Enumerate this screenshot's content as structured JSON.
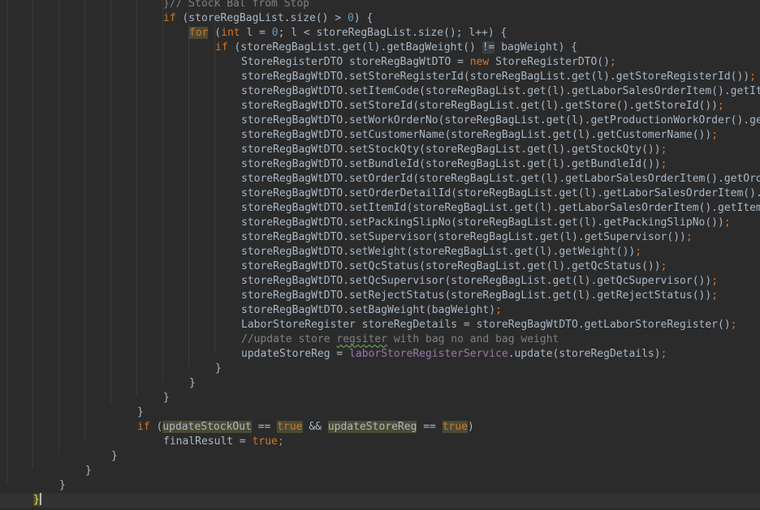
{
  "editor": {
    "lines": [
      {
        "indent": 6,
        "segs": [
          {
            "t": "}// Stock Bal from Stop",
            "k": "cmt"
          }
        ]
      },
      {
        "indent": 6,
        "segs": [
          {
            "t": "if",
            "k": "kw"
          },
          {
            "t": " (storeRegBagList.size() > "
          },
          {
            "t": "0",
            "k": "num"
          },
          {
            "t": ") {"
          }
        ]
      },
      {
        "indent": 7,
        "segs": [
          {
            "t": "for",
            "k": "kwhl"
          },
          {
            "t": " ("
          },
          {
            "t": "int",
            "k": "kw"
          },
          {
            "t": " l = "
          },
          {
            "t": "0",
            "k": "num"
          },
          {
            "t": "; l < storeRegBagList.size(); l++) {"
          }
        ]
      },
      {
        "indent": 8,
        "segs": [
          {
            "t": "if",
            "k": "kw"
          },
          {
            "t": " (storeRegBagList.get(l).getBagWeight() "
          },
          {
            "t": "!=",
            "k": "op"
          },
          {
            "t": " bagWeight) {"
          }
        ]
      },
      {
        "indent": 9,
        "segs": [
          {
            "t": "StoreRegisterDTO storeRegBagWtDTO = "
          },
          {
            "t": "new",
            "k": "kw"
          },
          {
            "t": " StoreRegisterDTO()"
          },
          {
            "t": ";",
            "k": "kw"
          }
        ]
      },
      {
        "indent": 9,
        "segs": [
          {
            "t": "storeRegBagWtDTO.setStoreRegisterId(storeRegBagList.get(l).getStoreRegisterId())"
          },
          {
            "t": ";",
            "k": "kw"
          }
        ]
      },
      {
        "indent": 9,
        "segs": [
          {
            "t": "storeRegBagWtDTO.setItemCode(storeRegBagList.get(l).getLaborSalesOrderItem().getItemCode())"
          },
          {
            "t": ";",
            "k": "kw"
          }
        ]
      },
      {
        "indent": 9,
        "segs": [
          {
            "t": "storeRegBagWtDTO.setStoreId(storeRegBagList.get(l).getStore().getStoreId())"
          },
          {
            "t": ";",
            "k": "kw"
          }
        ]
      },
      {
        "indent": 9,
        "segs": [
          {
            "t": "storeRegBagWtDTO.setWorkOrderNo(storeRegBagList.get(l).getProductionWorkOrder().getWorkOrderNo())"
          },
          {
            "t": ";",
            "k": "kw"
          }
        ]
      },
      {
        "indent": 9,
        "segs": [
          {
            "t": "storeRegBagWtDTO.setCustomerName(storeRegBagList.get(l).getCustomerName())"
          },
          {
            "t": ";",
            "k": "kw"
          }
        ]
      },
      {
        "indent": 9,
        "segs": [
          {
            "t": "storeRegBagWtDTO.setStockQty(storeRegBagList.get(l).getStockQty())"
          },
          {
            "t": ";",
            "k": "kw"
          }
        ]
      },
      {
        "indent": 9,
        "segs": [
          {
            "t": "storeRegBagWtDTO.setBundleId(storeRegBagList.get(l).getBundleId())"
          },
          {
            "t": ";",
            "k": "kw"
          }
        ]
      },
      {
        "indent": 9,
        "segs": [
          {
            "t": "storeRegBagWtDTO.setOrderId(storeRegBagList.get(l).getLaborSalesOrderItem().getOrderId())"
          },
          {
            "t": ";",
            "k": "kw"
          }
        ]
      },
      {
        "indent": 9,
        "segs": [
          {
            "t": "storeRegBagWtDTO.setOrderDetailId(storeRegBagList.get(l).getLaborSalesOrderItem().getOrderDetailId())"
          },
          {
            "t": ";",
            "k": "kw"
          }
        ]
      },
      {
        "indent": 9,
        "segs": [
          {
            "t": "storeRegBagWtDTO.setItemId(storeRegBagList.get(l).getLaborSalesOrderItem().getItemId())"
          },
          {
            "t": ";",
            "k": "kw"
          }
        ]
      },
      {
        "indent": 9,
        "segs": [
          {
            "t": "storeRegBagWtDTO.setPackingSlipNo(storeRegBagList.get(l).getPackingSlipNo())"
          },
          {
            "t": ";",
            "k": "kw"
          }
        ]
      },
      {
        "indent": 9,
        "segs": [
          {
            "t": "storeRegBagWtDTO.setSupervisor(storeRegBagList.get(l).getSupervisor())"
          },
          {
            "t": ";",
            "k": "kw"
          }
        ]
      },
      {
        "indent": 9,
        "segs": [
          {
            "t": "storeRegBagWtDTO.setWeight(storeRegBagList.get(l).getWeight())"
          },
          {
            "t": ";",
            "k": "kw"
          }
        ]
      },
      {
        "indent": 9,
        "segs": [
          {
            "t": "storeRegBagWtDTO.setQcStatus(storeRegBagList.get(l).getQcStatus())"
          },
          {
            "t": ";",
            "k": "kw"
          }
        ]
      },
      {
        "indent": 9,
        "segs": [
          {
            "t": "storeRegBagWtDTO.setQcSupervisor(storeRegBagList.get(l).getQcSupervisor())"
          },
          {
            "t": ";",
            "k": "kw"
          }
        ]
      },
      {
        "indent": 9,
        "segs": [
          {
            "t": "storeRegBagWtDTO.setRejectStatus(storeRegBagList.get(l).getRejectStatus())"
          },
          {
            "t": ";",
            "k": "kw"
          }
        ]
      },
      {
        "indent": 9,
        "segs": [
          {
            "t": "storeRegBagWtDTO.setBagWeight(bagWeight)"
          },
          {
            "t": ";",
            "k": "kw"
          }
        ]
      },
      {
        "indent": 9,
        "segs": [
          {
            "t": "LaborStoreRegister storeRegDetails = storeRegBagWtDTO.getLaborStoreRegister()"
          },
          {
            "t": ";",
            "k": "kw"
          }
        ]
      },
      {
        "indent": 9,
        "segs": [
          {
            "t": "//update store ",
            "k": "cmt"
          },
          {
            "t": "regsiter",
            "k": "cmttypo"
          },
          {
            "t": " with bag no and bag weight",
            "k": "cmt"
          }
        ]
      },
      {
        "indent": 9,
        "segs": [
          {
            "t": "updateStoreReg = "
          },
          {
            "t": "laborStoreRegisterService",
            "k": "fld"
          },
          {
            "t": ".update(storeRegDetails)"
          },
          {
            "t": ";",
            "k": "kw"
          }
        ]
      },
      {
        "indent": 8,
        "segs": [
          {
            "t": "}"
          }
        ]
      },
      {
        "indent": 7,
        "segs": [
          {
            "t": "}"
          }
        ]
      },
      {
        "indent": 6,
        "segs": [
          {
            "t": "}"
          }
        ]
      },
      {
        "indent": 5,
        "segs": [
          {
            "t": "}"
          }
        ]
      },
      {
        "indent": 5,
        "segs": [
          {
            "t": "if",
            "k": "kw"
          },
          {
            "t": " ("
          },
          {
            "t": "updateStockOut",
            "k": "hl"
          },
          {
            "t": " == "
          },
          {
            "t": "true",
            "k": "kwhl"
          },
          {
            "t": " && "
          },
          {
            "t": "updateStoreReg",
            "k": "hl"
          },
          {
            "t": " == "
          },
          {
            "t": "true",
            "k": "kwhl"
          },
          {
            "t": ")"
          }
        ]
      },
      {
        "indent": 6,
        "segs": [
          {
            "t": "finalResult = "
          },
          {
            "t": "true",
            "k": "kw"
          },
          {
            "t": ";",
            "k": "kw"
          }
        ]
      },
      {
        "indent": 4,
        "segs": [
          {
            "t": "}"
          }
        ]
      },
      {
        "indent": 3,
        "segs": [
          {
            "t": "}"
          }
        ]
      },
      {
        "indent": 2,
        "segs": [
          {
            "t": "}"
          }
        ]
      },
      {
        "indent": 1,
        "segs": [
          {
            "t": "}",
            "k": "brace"
          }
        ],
        "current": true
      }
    ]
  }
}
